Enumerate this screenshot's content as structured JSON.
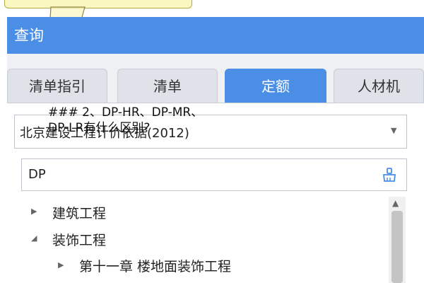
{
  "header": {
    "title": "查询"
  },
  "tabs": [
    {
      "label": "清单指引"
    },
    {
      "label": "清单"
    },
    {
      "label": "定额"
    },
    {
      "label": "人材机"
    }
  ],
  "selected_tab": "定额",
  "library_select": {
    "value": "北京建设工程计价依据(2012)"
  },
  "note": {
    "text": "### 2、DP-HR、DP-MR、DP-LR有什么区别?"
  },
  "search": {
    "value": "DP"
  },
  "tree": {
    "items": [
      {
        "label": "建筑工程"
      },
      {
        "label": "装饰工程"
      },
      {
        "label": "第十一章 楼地面装饰工程"
      }
    ]
  },
  "colors": {
    "accent": "#4b8ee6",
    "callout": "#fbf7c0"
  }
}
